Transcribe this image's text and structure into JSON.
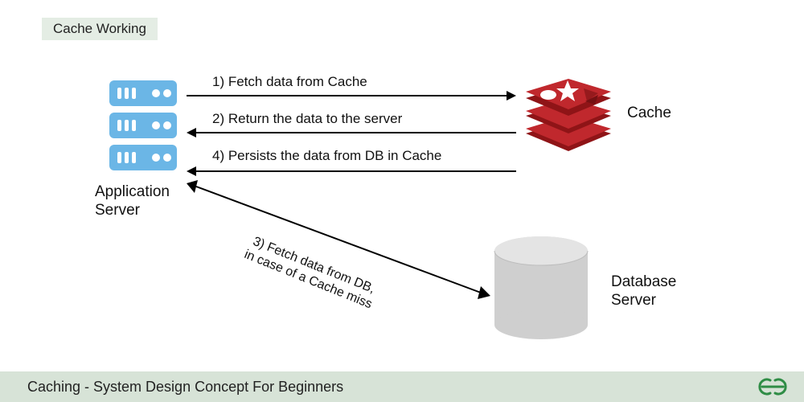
{
  "title": "Cache Working",
  "footer": "Caching - System Design Concept For Beginners",
  "nodes": {
    "app_server": "Application\nServer",
    "cache": "Cache",
    "db": "Database\nServer"
  },
  "flows": {
    "f1": "1) Fetch data from Cache",
    "f2": "2) Return the data to the server",
    "f3": "3) Fetch data from DB,\nin case of a Cache miss",
    "f4": "4) Persists the data from DB in Cache"
  },
  "colors": {
    "server": "#6bb6e6",
    "cache": "#b72025",
    "db": "#cfcfcf",
    "brand": "#2f8d46"
  }
}
